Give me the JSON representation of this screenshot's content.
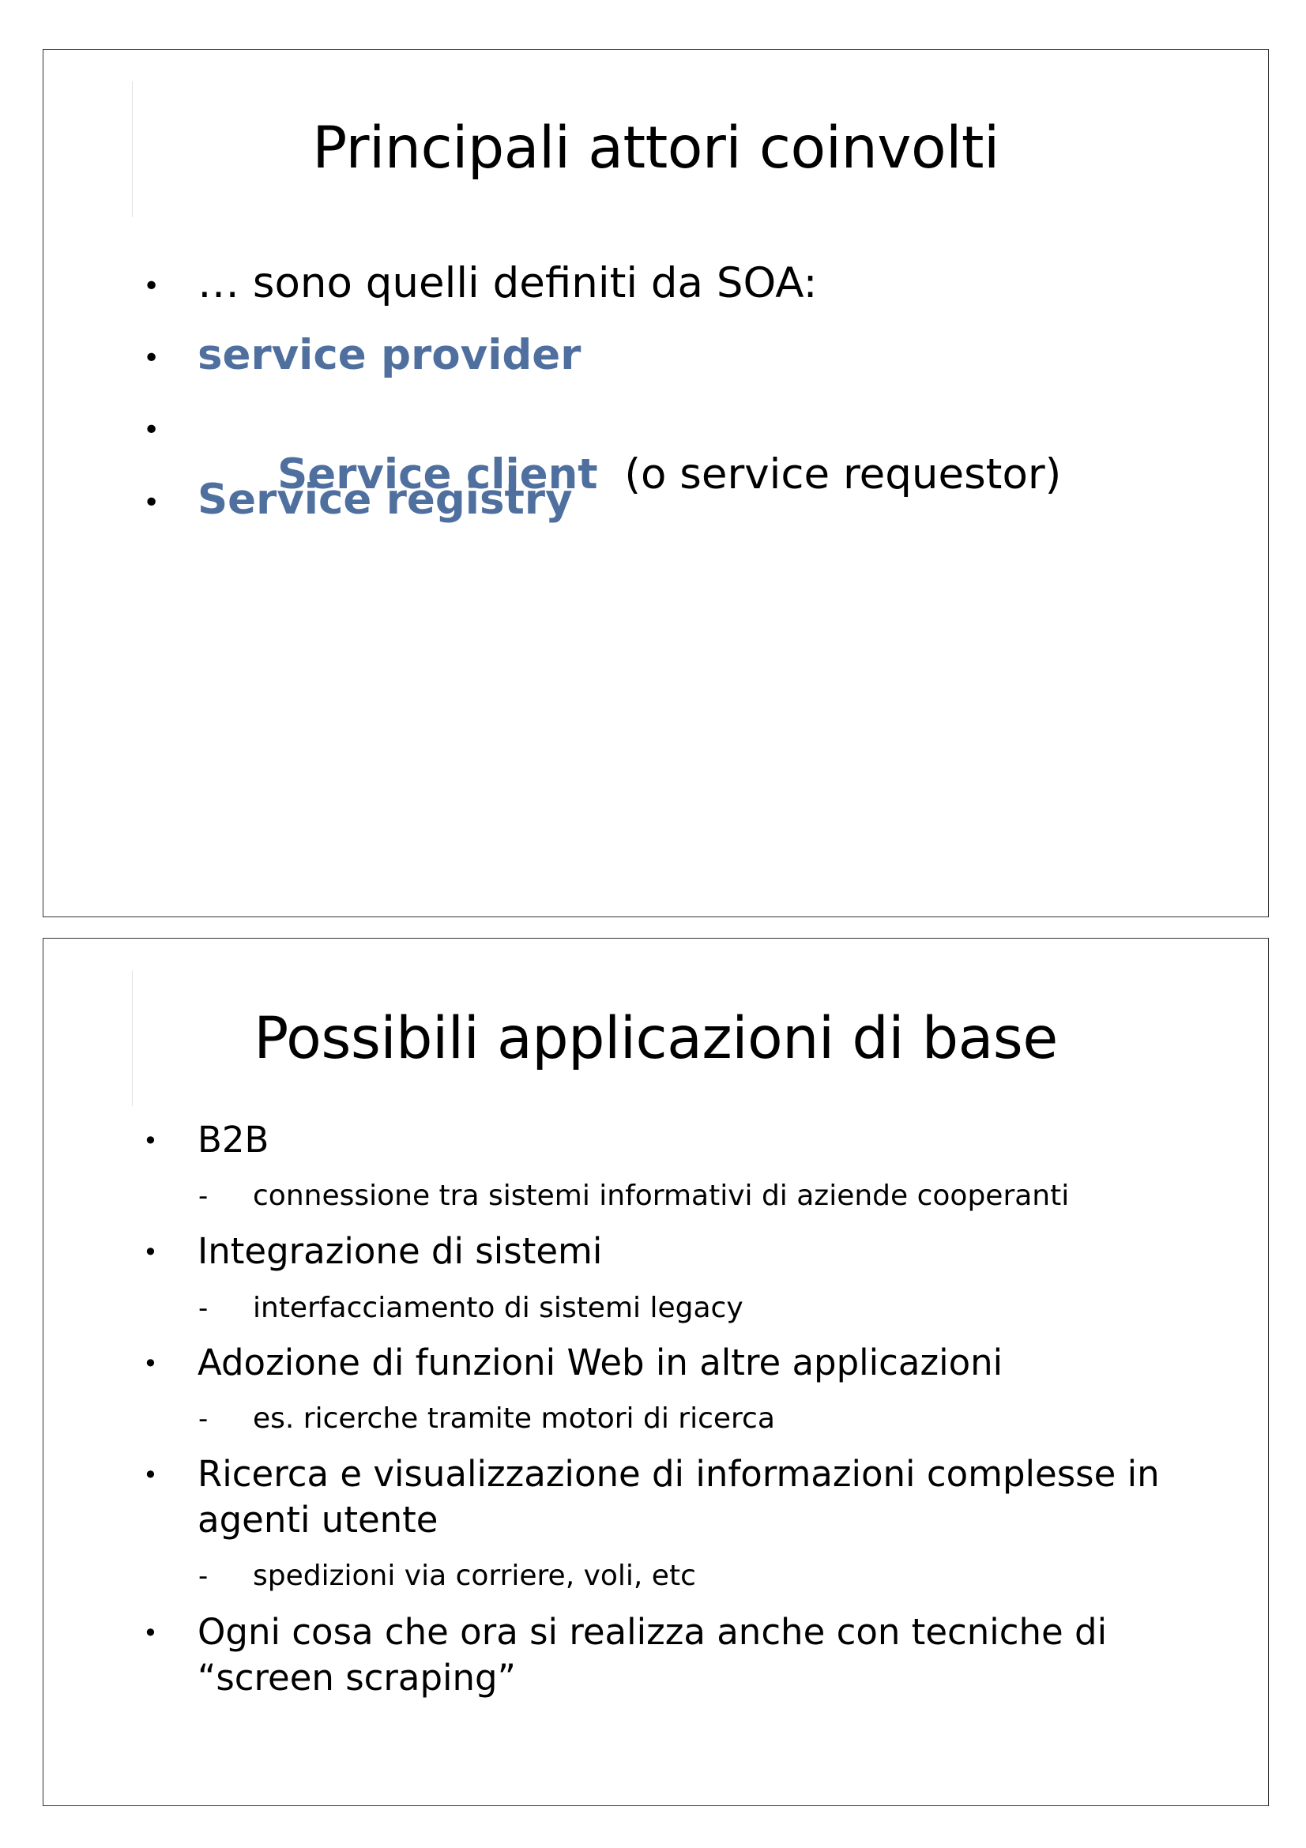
{
  "slides": [
    {
      "title": "Principali attori coinvolti",
      "bullets": [
        {
          "parts": [
            {
              "text": "… sono quelli definiti da SOA:",
              "style": "plain"
            }
          ]
        },
        {
          "parts": [
            {
              "text": "service provider",
              "style": "accent"
            }
          ]
        },
        {
          "parts": [
            {
              "text": "Service client",
              "style": "accent"
            },
            {
              "text": "  (o service requestor)",
              "style": "plain"
            }
          ]
        },
        {
          "parts": [
            {
              "text": "Service registry",
              "style": "accent"
            }
          ]
        }
      ]
    },
    {
      "title": "Possibili applicazioni di base",
      "bullets": [
        {
          "text": "B2B",
          "sub": "connessione tra sistemi informativi di aziende cooperanti"
        },
        {
          "text": "Integrazione di sistemi",
          "sub": "interfacciamento di sistemi legacy"
        },
        {
          "text": "Adozione di funzioni Web in altre applicazioni",
          "sub": "es. ricerche tramite motori di ricerca"
        },
        {
          "text": "Ricerca e visualizzazione di informazioni complesse in agenti utente",
          "sub": "spedizioni via corriere, voli, etc"
        },
        {
          "text": "Ogni cosa che ora si realizza anche con tecniche di “screen scraping”"
        }
      ]
    }
  ],
  "bullet_symbol": "•",
  "sub_bullet_symbol": "-",
  "colors": {
    "accent": "#4f6f9f",
    "text": "#000000",
    "border": "#333333"
  }
}
